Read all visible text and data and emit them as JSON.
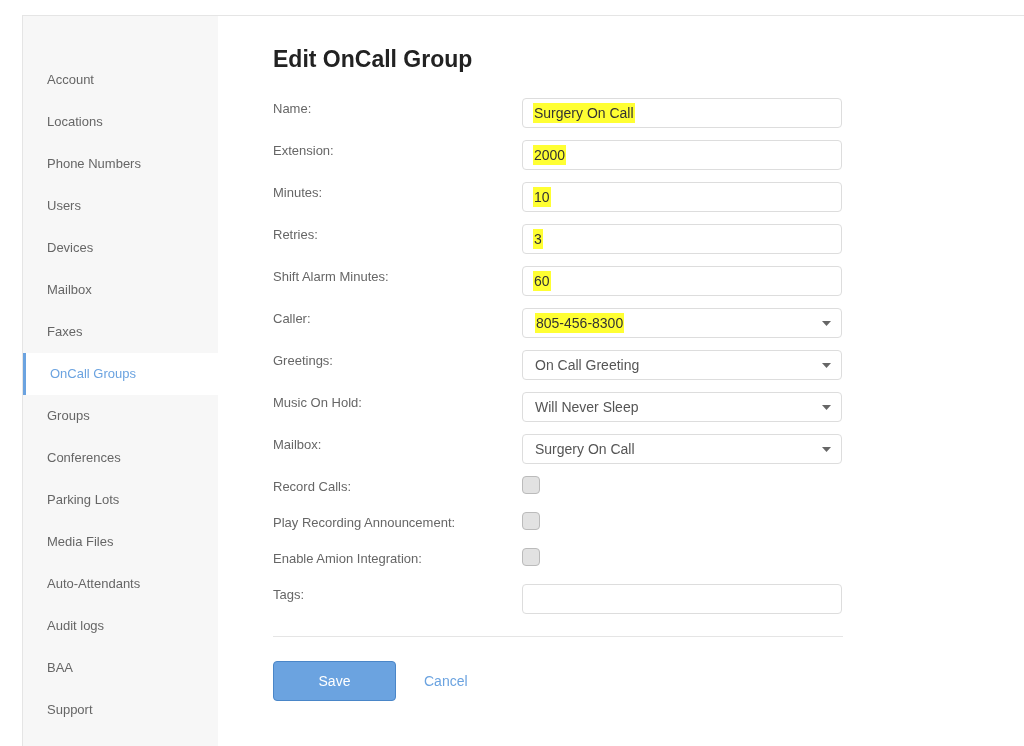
{
  "sidebar": {
    "items": [
      {
        "label": "Account",
        "selected": false
      },
      {
        "label": "Locations",
        "selected": false
      },
      {
        "label": "Phone Numbers",
        "selected": false
      },
      {
        "label": "Users",
        "selected": false
      },
      {
        "label": "Devices",
        "selected": false
      },
      {
        "label": "Mailbox",
        "selected": false
      },
      {
        "label": "Faxes",
        "selected": false
      },
      {
        "label": "OnCall Groups",
        "selected": true
      },
      {
        "label": "Groups",
        "selected": false
      },
      {
        "label": "Conferences",
        "selected": false
      },
      {
        "label": "Parking Lots",
        "selected": false
      },
      {
        "label": "Media Files",
        "selected": false
      },
      {
        "label": "Auto-Attendants",
        "selected": false
      },
      {
        "label": "Audit logs",
        "selected": false
      },
      {
        "label": "BAA",
        "selected": false
      },
      {
        "label": "Support",
        "selected": false
      }
    ]
  },
  "form": {
    "title": "Edit OnCall Group",
    "fields": [
      {
        "kind": "text",
        "label": "Name:",
        "value": "Surgery On Call",
        "highlighted": true
      },
      {
        "kind": "text",
        "label": "Extension:",
        "value": "2000",
        "highlighted": true
      },
      {
        "kind": "text",
        "label": "Minutes:",
        "value": "10",
        "highlighted": true
      },
      {
        "kind": "text",
        "label": "Retries:",
        "value": "3",
        "highlighted": true
      },
      {
        "kind": "text",
        "label": "Shift Alarm Minutes:",
        "value": "60",
        "highlighted": true
      },
      {
        "kind": "select",
        "label": "Caller:",
        "value": "805-456-8300",
        "highlighted": true
      },
      {
        "kind": "select",
        "label": "Greetings:",
        "value": "On Call Greeting",
        "highlighted": false
      },
      {
        "kind": "select",
        "label": "Music On Hold:",
        "value": "Will Never Sleep",
        "highlighted": false
      },
      {
        "kind": "select",
        "label": "Mailbox:",
        "value": "Surgery On Call",
        "highlighted": false
      },
      {
        "kind": "checkbox",
        "label": "Record Calls:",
        "checked": false
      },
      {
        "kind": "checkbox",
        "label": "Play Recording Announcement:",
        "checked": false
      },
      {
        "kind": "checkbox",
        "label": "Enable Amion Integration:",
        "checked": false
      },
      {
        "kind": "text",
        "label": "Tags:"
      }
    ],
    "buttons": {
      "save": "Save",
      "cancel": "Cancel"
    }
  }
}
